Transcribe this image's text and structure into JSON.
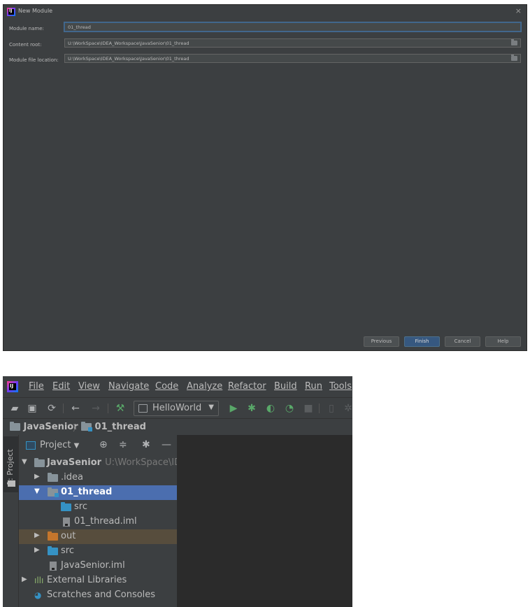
{
  "dialog": {
    "title": "New Module",
    "close": "×",
    "fields": {
      "module_name_label": "Module name:",
      "module_name_value": "01_thread",
      "content_root_label": "Content root:",
      "content_root_value": "U:\\WorkSpace\\IDEA_Workspace\\JavaSenior\\01_thread",
      "module_file_location_label": "Module file location:",
      "module_file_location_value": "U:\\WorkSpace\\IDEA_Workspace\\JavaSenior\\01_thread"
    },
    "buttons": {
      "previous": "Previous",
      "finish": "Finish",
      "cancel": "Cancel",
      "help": "Help"
    }
  },
  "ide": {
    "menu": [
      "File",
      "Edit",
      "View",
      "Navigate",
      "Code",
      "Analyze",
      "Refactor",
      "Build",
      "Run",
      "Tools"
    ],
    "run_config": "HelloWorld",
    "breadcrumb": [
      "JavaSenior",
      "01_thread"
    ],
    "side_tab": "1: Project",
    "panel_title": "Project",
    "tree": {
      "root_name": "JavaSenior",
      "root_path": "U:\\WorkSpace\\IDE",
      "idea": ".idea",
      "module": "01_thread",
      "module_src": "src",
      "module_iml": "01_thread.iml",
      "out": "out",
      "src": "src",
      "root_iml": "JavaSenior.iml",
      "external_libraries": "External Libraries",
      "scratches": "Scratches and Consoles"
    }
  },
  "colors": {
    "dialog_bg": "#3c3f41",
    "primary_button": "#365880",
    "selection": "#4b6eaf",
    "run_green": "#59a869",
    "module_folder_blue": "#3592c4",
    "excluded_orange": "#c5762c"
  }
}
